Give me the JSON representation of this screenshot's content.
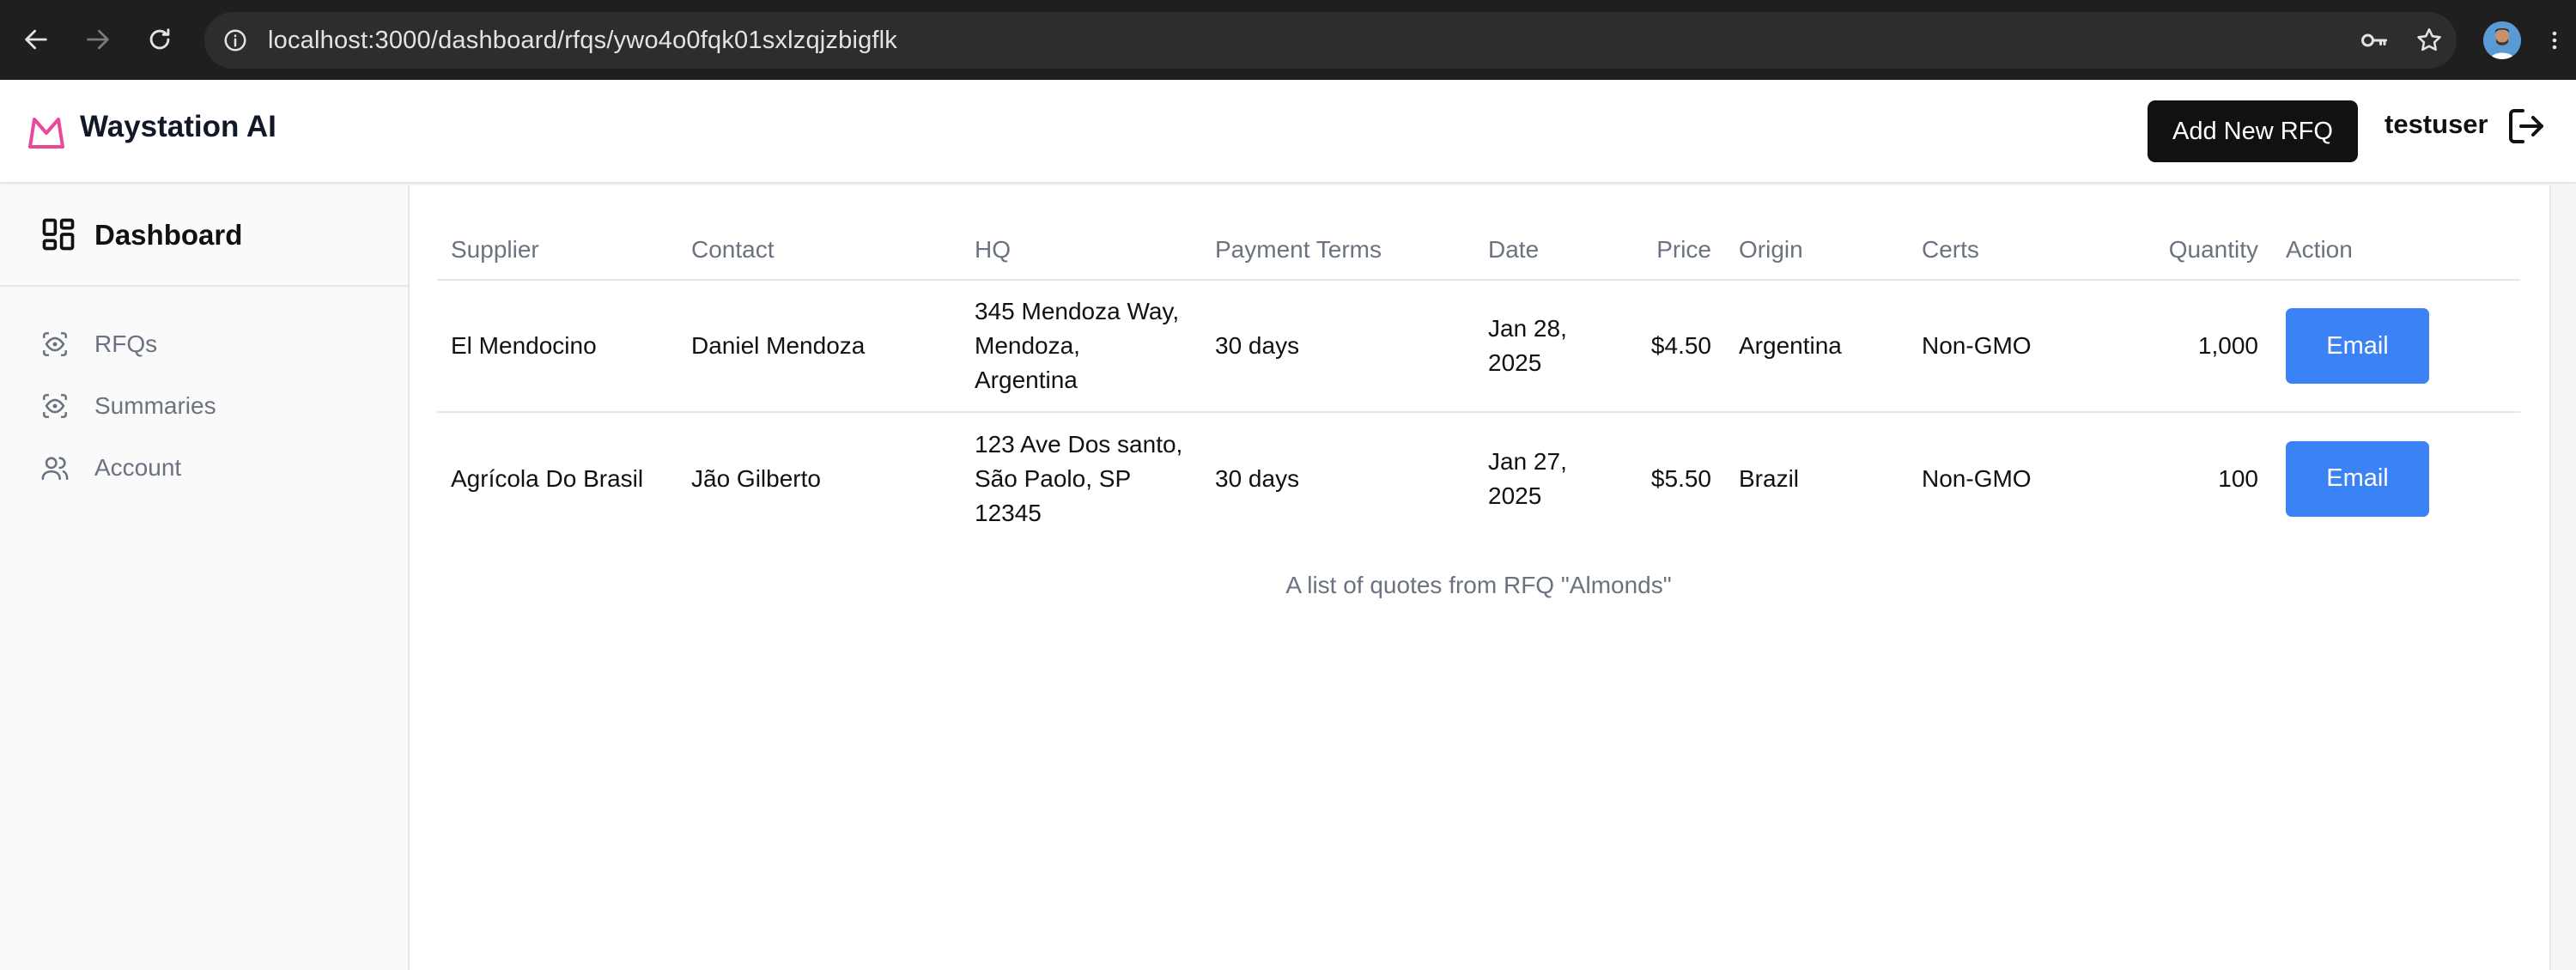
{
  "browser": {
    "url": "localhost:3000/dashboard/rfqs/ywo4o0fqk01sxlzqjzbigflk"
  },
  "header": {
    "brand": "Waystation AI",
    "add_button": "Add New RFQ",
    "username": "testuser",
    "accent_color": "#ec4899"
  },
  "sidebar": {
    "title": "Dashboard",
    "items": [
      {
        "label": "RFQs",
        "icon": "eye-icon"
      },
      {
        "label": "Summaries",
        "icon": "eye-icon"
      },
      {
        "label": "Account",
        "icon": "users-icon"
      }
    ]
  },
  "table": {
    "columns": [
      "Supplier",
      "Contact",
      "HQ",
      "Payment Terms",
      "Date",
      "Price",
      "Origin",
      "Certs",
      "Quantity",
      "Action"
    ],
    "rows": [
      {
        "supplier": "El Mendocino",
        "contact": "Daniel Mendoza",
        "hq": "345 Mendoza Way, Mendoza, Argentina",
        "payment_terms": "30 days",
        "date": "Jan 28, 2025",
        "price": "$4.50",
        "origin": "Argentina",
        "certs": "Non-GMO",
        "quantity": "1,000",
        "action": "Email"
      },
      {
        "supplier": "Agrícola Do Brasil",
        "contact": "Jão Gilberto",
        "hq": "123 Ave Dos santo, São Paolo, SP 12345",
        "payment_terms": "30 days",
        "date": "Jan 27, 2025",
        "price": "$5.50",
        "origin": "Brazil",
        "certs": "Non-GMO",
        "quantity": "100",
        "action": "Email"
      }
    ],
    "caption": "A list of quotes from RFQ \"Almonds\""
  },
  "colors": {
    "email_button": "#3b82f6",
    "primary_button": "#111111"
  }
}
